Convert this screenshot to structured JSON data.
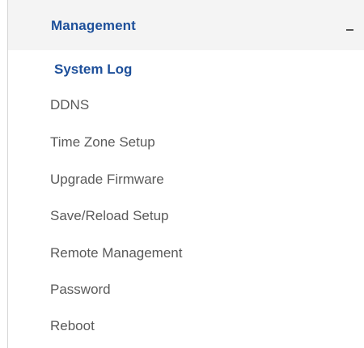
{
  "section": {
    "title": "Management",
    "collapse_icon": "minus-icon"
  },
  "menu": {
    "active_index": 0,
    "items": [
      {
        "label": "System Log"
      },
      {
        "label": "DDNS"
      },
      {
        "label": "Time Zone Setup"
      },
      {
        "label": "Upgrade Firmware"
      },
      {
        "label": "Save/Reload Setup"
      },
      {
        "label": "Remote Management"
      },
      {
        "label": "Password"
      },
      {
        "label": "Reboot"
      }
    ]
  },
  "colors": {
    "accent": "#1d4f9a",
    "text": "#5a5a5a",
    "header_bg": "#f4f4f4"
  }
}
